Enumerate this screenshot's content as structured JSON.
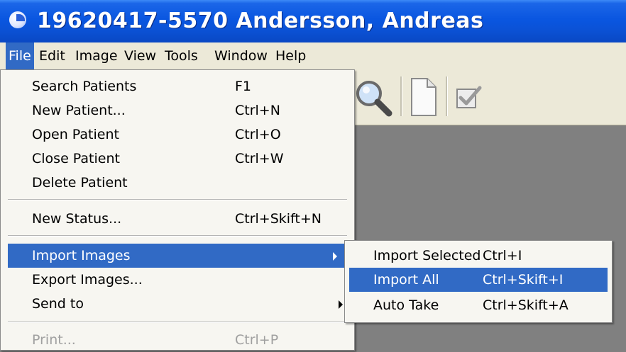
{
  "window": {
    "title": "19620417-5570 Andersson, Andreas"
  },
  "menubar": {
    "items": [
      "File",
      "Edit",
      "Image",
      "View",
      "Tools",
      "Window",
      "Help"
    ]
  },
  "toolbar": {
    "icons": [
      "magnifier-icon",
      "new-document-icon",
      "checkbox-icon"
    ]
  },
  "file_menu": {
    "items": [
      {
        "label": "Search Patients",
        "shortcut": "F1"
      },
      {
        "label": "New Patient...",
        "shortcut": "Ctrl+N"
      },
      {
        "label": "Open Patient",
        "shortcut": "Ctrl+O"
      },
      {
        "label": "Close Patient",
        "shortcut": "Ctrl+W"
      },
      {
        "label": "Delete Patient",
        "shortcut": ""
      },
      {
        "label": "New Status...",
        "shortcut": "Ctrl+Skift+N"
      },
      {
        "label": "Import Images",
        "shortcut": "",
        "submenu": true,
        "highlighted": true
      },
      {
        "label": "Export Images...",
        "shortcut": ""
      },
      {
        "label": "Send to",
        "shortcut": "",
        "submenu": true
      },
      {
        "label": "Print...",
        "shortcut": "Ctrl+P",
        "disabled": true
      }
    ]
  },
  "import_submenu": {
    "items": [
      {
        "label": "Import Selected",
        "shortcut": "Ctrl+I"
      },
      {
        "label": "Import All",
        "shortcut": "Ctrl+Skift+I",
        "highlighted": true
      },
      {
        "label": "Auto Take",
        "shortcut": "Ctrl+Skift+A"
      }
    ]
  },
  "colors": {
    "title_bar": "#0a56e0",
    "highlight": "#316ac5",
    "menu_bg": "#f7f6f1",
    "workspace": "#808080"
  }
}
